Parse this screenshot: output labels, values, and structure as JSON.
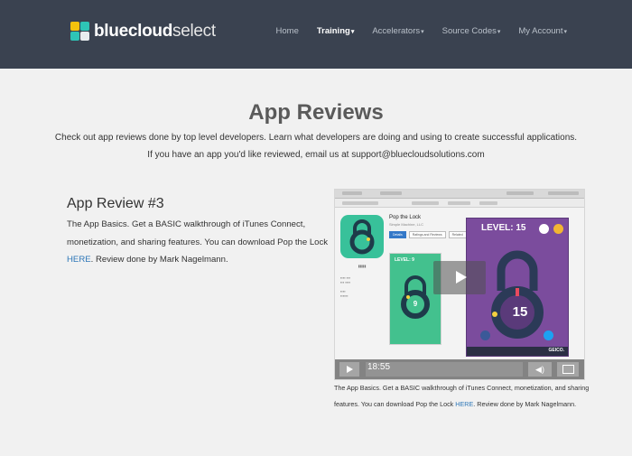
{
  "header": {
    "logo": {
      "bold": "bluecloud",
      "light": "select"
    },
    "nav": [
      {
        "label": "Home",
        "active": false,
        "dropdown": false
      },
      {
        "label": "Training",
        "active": true,
        "dropdown": true
      },
      {
        "label": "Accelerators",
        "active": false,
        "dropdown": true
      },
      {
        "label": "Source Codes",
        "active": false,
        "dropdown": true
      },
      {
        "label": "My Account",
        "active": false,
        "dropdown": true
      }
    ]
  },
  "hero": {
    "title": "App Reviews",
    "line1": "Check out app reviews done by top level developers. Learn what developers are doing and using to create successful applications.",
    "line2": "If you have an app you'd like reviewed, email us at support@bluecloudsolutions.com"
  },
  "review": {
    "title": "App Review #3",
    "body_before": "The App Basics.  Get a BASIC walkthrough of iTunes Connect, monetization, and sharing features.  You can download Pop the Lock ",
    "link": "HERE",
    "body_after": ".  Review done by Mark Nagelmann."
  },
  "video": {
    "time": "18:55",
    "app_name": "Pop the Lock",
    "app_dev": "Simple Machine, LLC",
    "tabs": [
      "Details",
      "Ratings and Reviews",
      "Related"
    ],
    "green_level": "LEVEL: 9",
    "green_number": "9",
    "purple_level": "LEVEL: 15",
    "purple_number": "15",
    "ad_text": "GEICO."
  },
  "caption": {
    "before": "The App Basics.  Get a BASIC walkthrough of iTunes Connect, monetization, and sharing features.  You can download Pop the Lock ",
    "link": "HERE",
    "after": ".  Review done by Mark Nagelmann."
  },
  "colors": {
    "nav_bg": "#3a4250",
    "page_bg": "#f1f1f1",
    "link": "#2e77b8",
    "purple": "#7b4c9d",
    "green": "#43c18e"
  }
}
